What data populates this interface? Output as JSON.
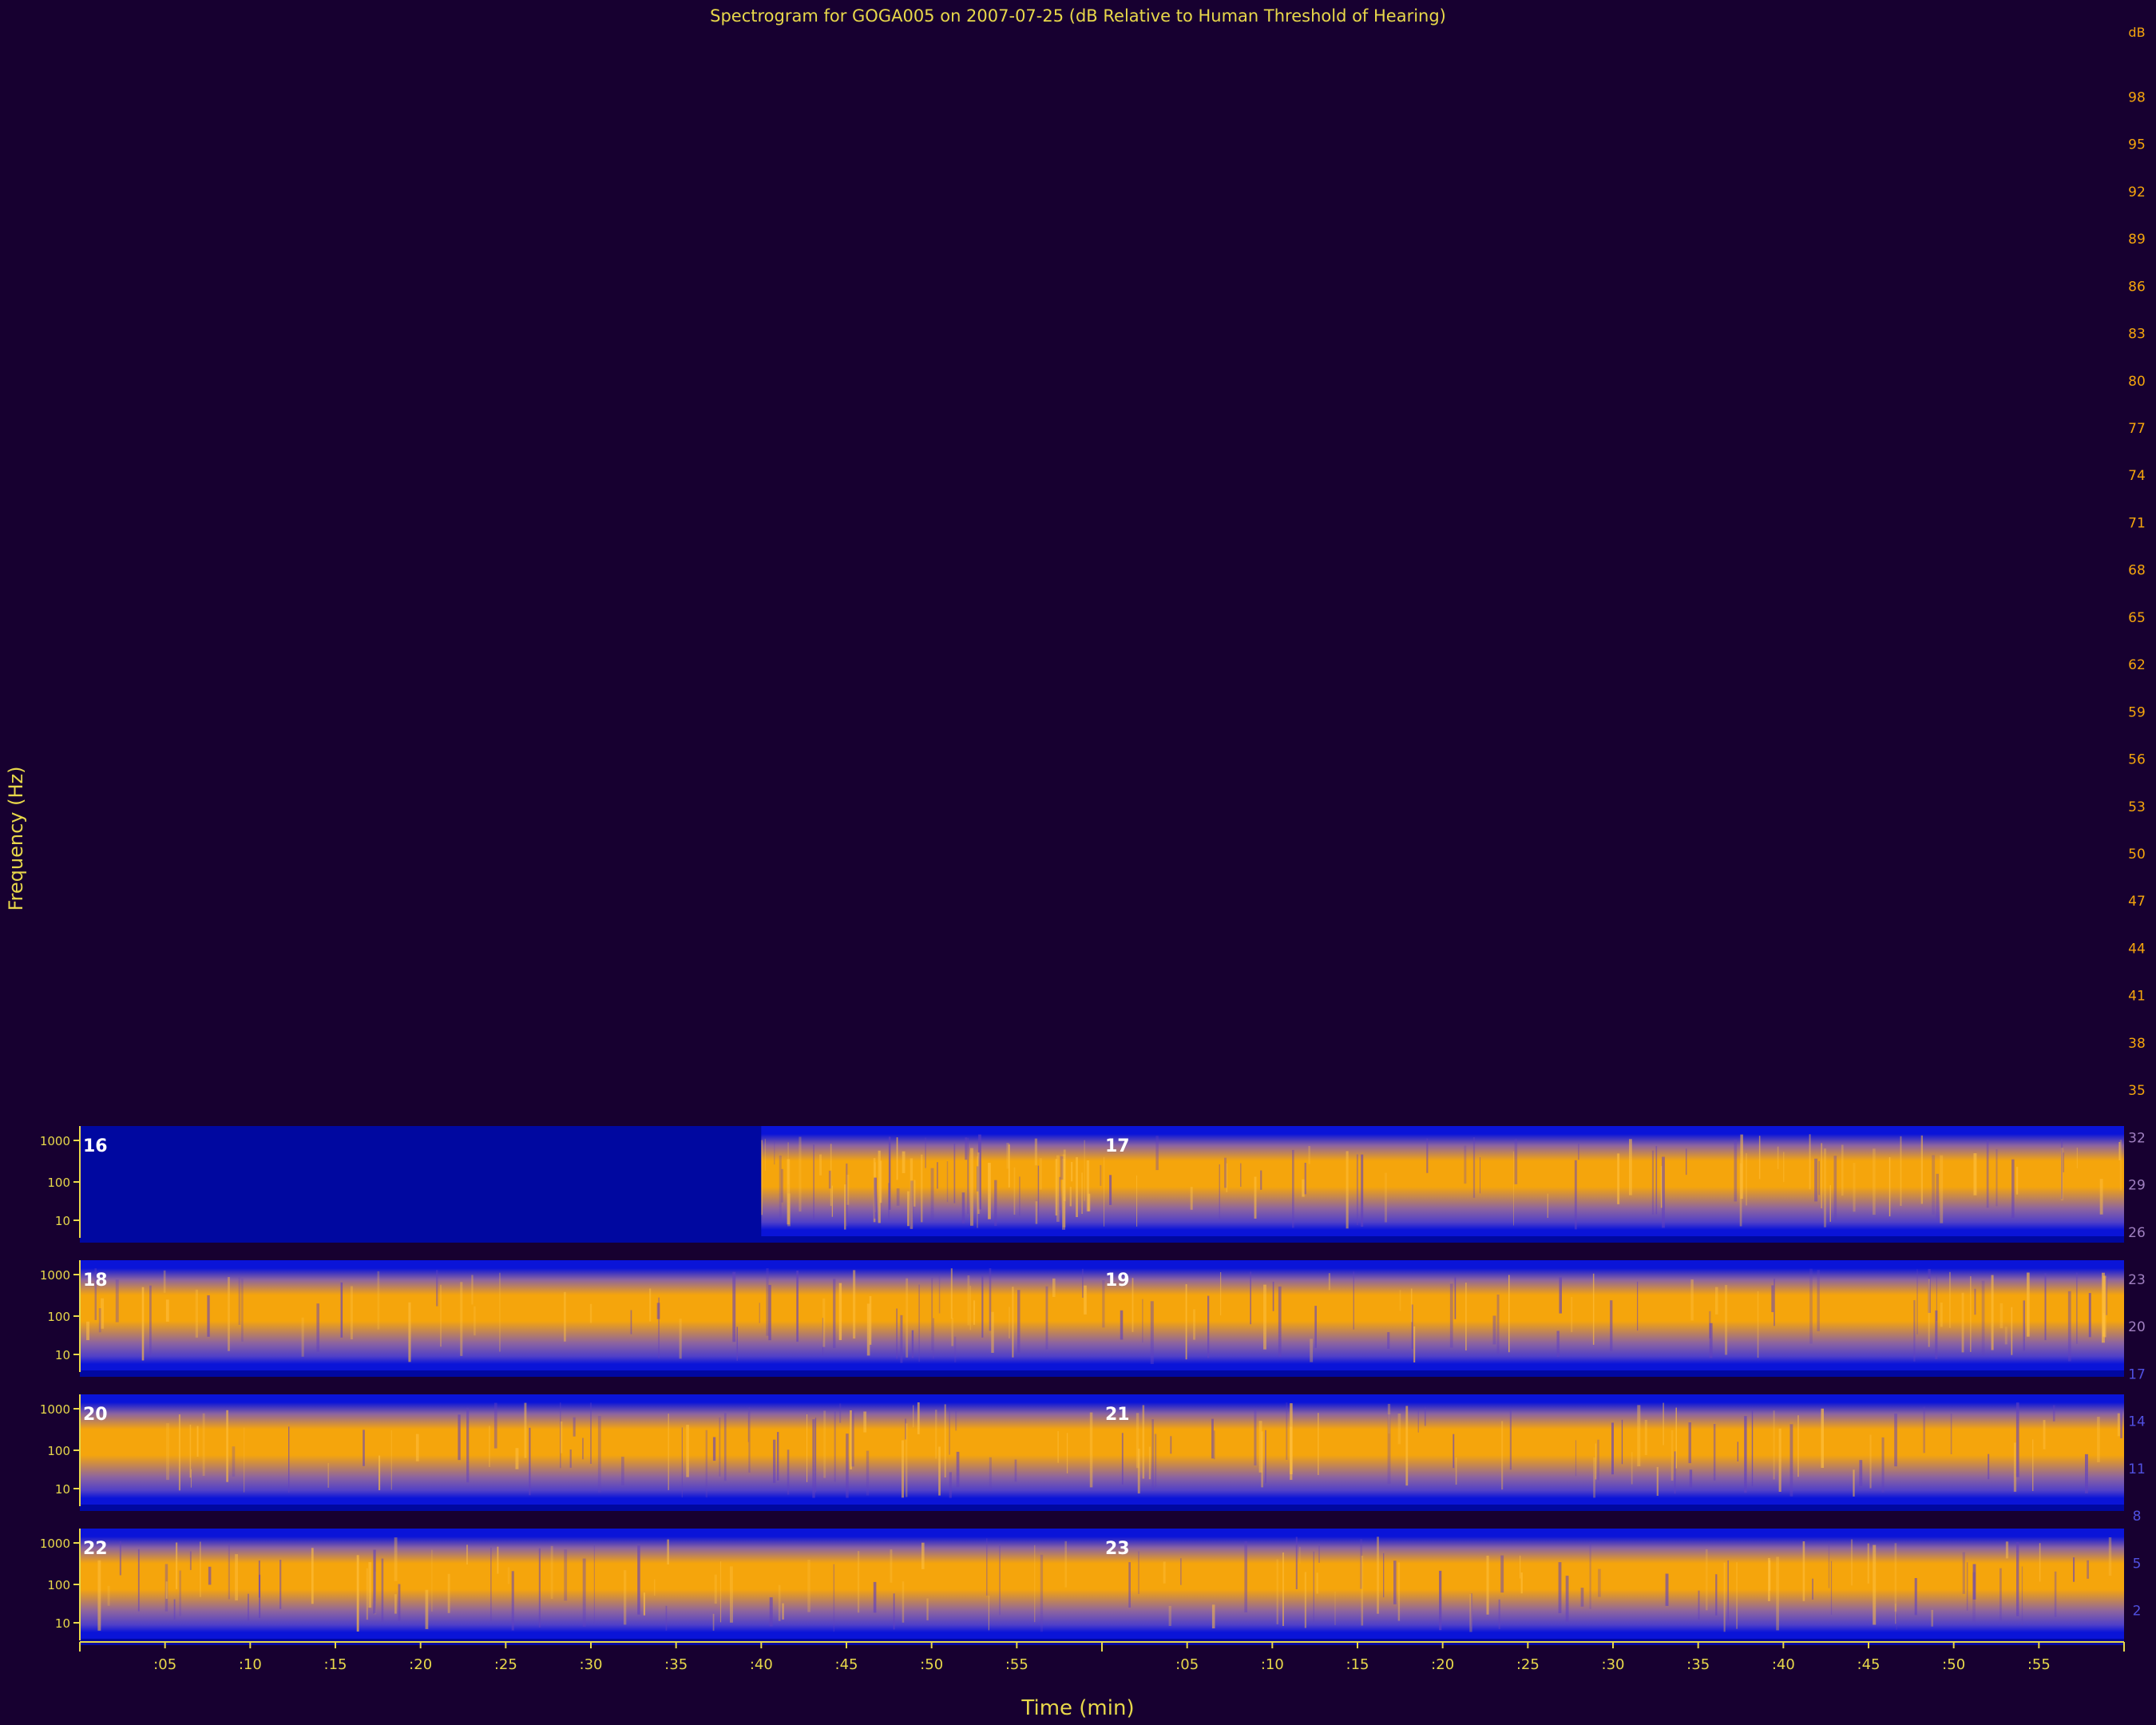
{
  "chart_data": {
    "type": "heatmap",
    "title": "Spectrogram for GOGA005 on 2007-07-25 (dB Relative to Human Threshold of Hearing)",
    "xlabel": "Time (min)",
    "ylabel": "Frequency (Hz)",
    "colorbar": {
      "unit": "dB",
      "ticks": [
        98,
        95,
        92,
        89,
        86,
        83,
        80,
        77,
        74,
        71,
        68,
        65,
        62,
        59,
        56,
        53,
        50,
        47,
        44,
        41,
        38,
        35,
        32,
        29,
        26,
        23,
        20,
        17,
        14,
        11,
        8,
        5,
        2
      ],
      "range": [
        0,
        100
      ]
    },
    "hours": [
      {
        "hour": "16",
        "data_start_min": 40
      },
      {
        "hour": "17",
        "data_start_min": 0
      },
      {
        "hour": "18",
        "data_start_min": 0
      },
      {
        "hour": "19",
        "data_start_min": 0
      },
      {
        "hour": "20",
        "data_start_min": 0
      },
      {
        "hour": "21",
        "data_start_min": 0
      },
      {
        "hour": "22",
        "data_start_min": 0
      },
      {
        "hour": "23",
        "data_start_min": 0
      }
    ],
    "freq_ticks": [
      "1000",
      "100",
      "10"
    ],
    "x_ticks": [
      ":05",
      ":10",
      ":15",
      ":20",
      ":25",
      ":30",
      ":35",
      ":40",
      ":45",
      ":50",
      ":55",
      ":05",
      ":10",
      ":15",
      ":20",
      ":25",
      ":30",
      ":35",
      ":40",
      ":45",
      ":50",
      ":55"
    ],
    "x_range_min": [
      0,
      120
    ],
    "grid": false
  },
  "colors": {
    "background": "#170030",
    "text": "#e8d84a",
    "low": "#0a14d8",
    "mid": "#8c64a0",
    "high": "#f5a50c"
  }
}
